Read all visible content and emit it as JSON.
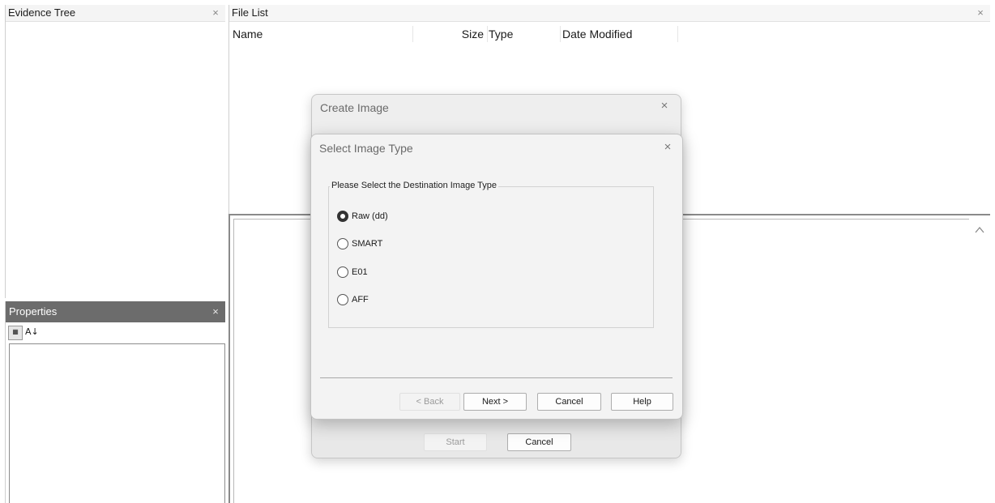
{
  "evidence_tree": {
    "title": "Evidence Tree",
    "close": "×"
  },
  "properties": {
    "title": "Properties",
    "close": "×",
    "toolbar": {
      "categorized": "▦",
      "alphabetical": "A↓"
    }
  },
  "file_list": {
    "title": "File List",
    "close": "×",
    "columns": [
      "Name",
      "Size",
      "Type",
      "Date Modified"
    ]
  },
  "create_image_dialog": {
    "title": "Create Image",
    "close": "×",
    "start_label": "Start",
    "cancel_label": "Cancel"
  },
  "select_image_type_dialog": {
    "title": "Select Image Type",
    "close": "×",
    "group_label": "Please Select the Destination Image Type",
    "options": [
      {
        "label": "Raw (dd)",
        "selected": true
      },
      {
        "label": "SMART",
        "selected": false
      },
      {
        "label": "E01",
        "selected": false
      },
      {
        "label": "AFF",
        "selected": false
      }
    ],
    "back_label": "< Back",
    "next_label": "Next >",
    "cancel_label": "Cancel",
    "help_label": "Help"
  },
  "icons": {
    "close": "close-icon",
    "scroll_up": "chevron-up-icon",
    "radio": "radio-button-icon"
  },
  "colors": {
    "properties_header_bg": "#6c6c6c",
    "dialog_bg": "#f3f3f3",
    "disabled_text": "#9a9a9a"
  }
}
